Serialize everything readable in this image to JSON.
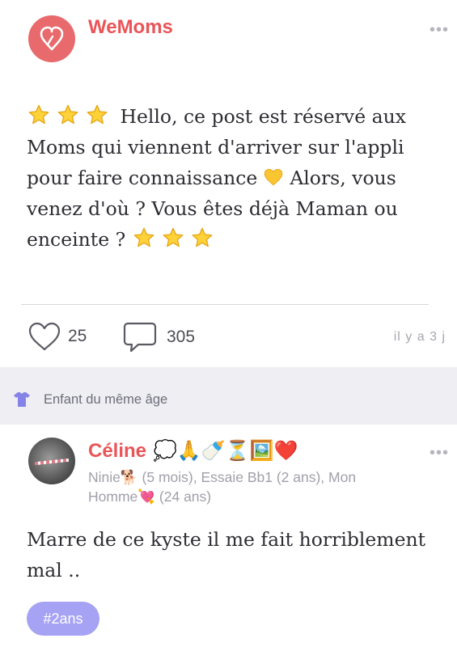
{
  "post1": {
    "author": "WeMoms",
    "text_line1": "Hello, ce post est réservé aux",
    "text_line2": "Moms qui viennent d'arriver sur l'appli",
    "text_line3a": "pour faire connaissance",
    "text_line3b": "Alors, vous",
    "text_line4": "venez d'où ? Vous êtes déjà Maman ou",
    "text_line5": "enceinte ?",
    "likes": "25",
    "comments": "305",
    "time": "il y a 3 j",
    "icons": [
      "heart-logo-icon",
      "star-emoji",
      "yellow-heart-emoji",
      "more-icon",
      "like-heart-icon",
      "comment-bubble-icon"
    ]
  },
  "section": {
    "label": "Enfant du même âge",
    "icon": "baby-onesie-icon"
  },
  "post2": {
    "author": "Céline",
    "author_emojis": "💭🙏🍼⏳🖼️❤️",
    "sub_line1": "Ninie🐕 (5 mois), Essaie Bb1 (2 ans), Mon",
    "sub_line2": "Homme💘 (24 ans)",
    "text_line1": "Marre de ce kyste il me fait horriblement",
    "text_line2": "mal ..",
    "tag": "#2ans"
  },
  "colors": {
    "brand": "#e86a6c",
    "author_name": "#e95558",
    "tag_bg": "#a6a2f4",
    "section_icon": "#8583e8"
  }
}
